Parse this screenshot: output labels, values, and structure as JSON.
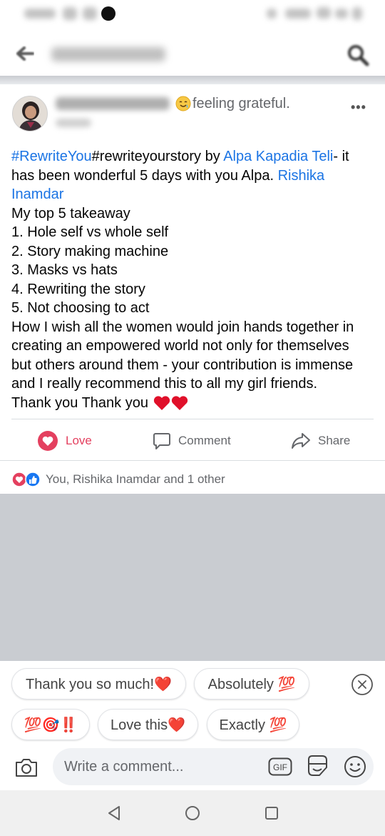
{
  "post": {
    "feeling": "feeling grateful.",
    "body_lines": [
      {
        "hashtag": "#RewriteYou",
        "text1": "#rewriteyourstory by ",
        "mention": "Alpa Kapadia Teli",
        "text2": "- it"
      },
      {
        "text": "has been wonderful 5 days with you Alpa. ",
        "mention": "Rishika"
      },
      {
        "mention": "Inamdar"
      },
      {
        "text": "My top 5 takeaway"
      },
      {
        "text": "1. Hole self vs whole self"
      },
      {
        "text": "2. Story  making machine"
      },
      {
        "text": "3. Masks vs hats"
      },
      {
        "text": "4. Rewriting the story"
      },
      {
        "text": "5. Not choosing to act"
      },
      {
        "text": "How I wish all the women would join hands together in"
      },
      {
        "text": "creating an empowered world not only for themselves"
      },
      {
        "text": "but others around them - your contribution is immense"
      },
      {
        "text": "and I really recommend this to all my girl friends."
      },
      {
        "text": "Thank you Thank you"
      }
    ]
  },
  "actions": {
    "love_label": "Love",
    "comment_label": "Comment",
    "share_label": "Share"
  },
  "reactions": {
    "summary": "You, Rishika Inamdar and 1 other"
  },
  "quick_replies": [
    {
      "label": "Thank you so much!❤️"
    },
    {
      "label": "Absolutely 💯"
    },
    {
      "label": "💯🎯‼️"
    },
    {
      "label": "Love this❤️"
    },
    {
      "label": "Exactly 💯"
    }
  ],
  "comment_bar": {
    "placeholder": "Write a comment...",
    "gif_label": "GIF"
  },
  "icons": {
    "back": "back-arrow-icon",
    "search": "search-icon",
    "more": "more-options-icon",
    "love": "heart-icon",
    "comment": "comment-icon",
    "share": "share-icon",
    "camera": "camera-icon",
    "gif": "gif-icon",
    "sticker": "sticker-icon",
    "emoji": "emoji-icon",
    "close": "close-icon"
  },
  "colors": {
    "link": "#1b74e4",
    "love": "#e4405f",
    "secondary_text": "#65676b"
  }
}
